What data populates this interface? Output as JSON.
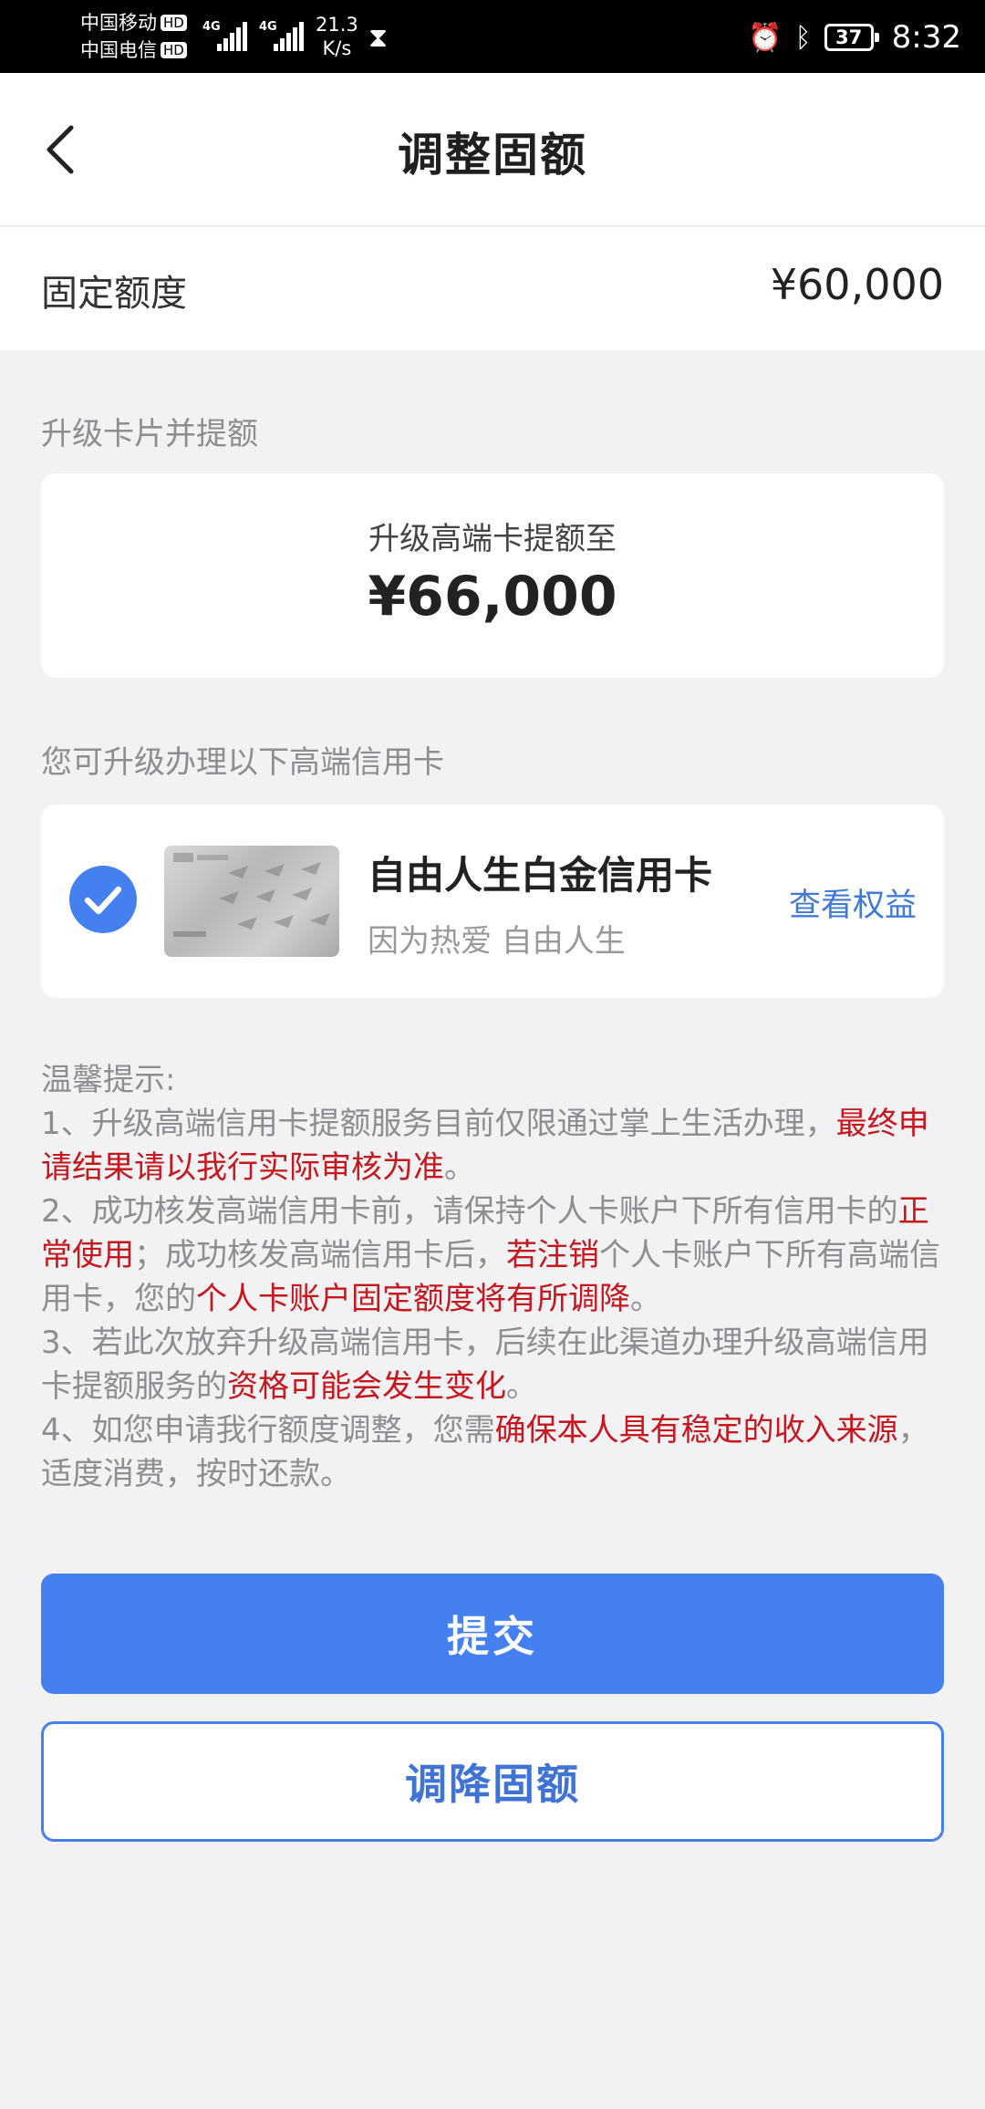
{
  "status_bar": {
    "carrier1": "中国移动",
    "carrier2": "中国电信",
    "hd_badge": "HD",
    "network": "4G",
    "speed_value": "21.3",
    "speed_unit": "K/s",
    "battery": "37",
    "time": "8:32"
  },
  "header": {
    "title": "调整固额"
  },
  "fixed_limit": {
    "label": "固定额度",
    "value": "¥60,000"
  },
  "upgrade": {
    "section_title": "升级卡片并提额",
    "subtitle": "升级高端卡提额至",
    "amount": "¥66,000"
  },
  "cards_section": {
    "title": "您可升级办理以下高端信用卡"
  },
  "card": {
    "name": "自由人生白金信用卡",
    "slogan": "因为热爱 自由人生",
    "benefit_link": "查看权益",
    "selected": true
  },
  "tips": {
    "title": "温馨提示:",
    "t1a": "1、升级高端信用卡提额服务目前仅限通过掌上生活办理，",
    "t1b": "最终申请结果请以我行实际审核为准",
    "t1c": "。",
    "t2a": "2、成功核发高端信用卡前，请保持个人卡账户下所有信用卡的",
    "t2b": "正常使用",
    "t2c": "；成功核发高端信用卡后，",
    "t2d": "若注销",
    "t2e": "个人卡账户下所有高端信用卡，您的",
    "t2f": "个人卡账户固定额度将有所调降",
    "t2g": "。",
    "t3a": "3、若此次放弃升级高端信用卡，后续在此渠道办理升级高端信用卡提额服务的",
    "t3b": "资格可能会发生变化",
    "t3c": "。",
    "t4a": "4、如您申请我行额度调整，您需",
    "t4b": "确保本人具有稳定的收入来源",
    "t4c": "，适度消费，按时还款。"
  },
  "buttons": {
    "submit": "提交",
    "reduce": "调降固额"
  },
  "colors": {
    "primary": "#4580f0",
    "warning_red": "#c8161d",
    "link": "#3f7ad9",
    "background": "#f2f2f4"
  }
}
